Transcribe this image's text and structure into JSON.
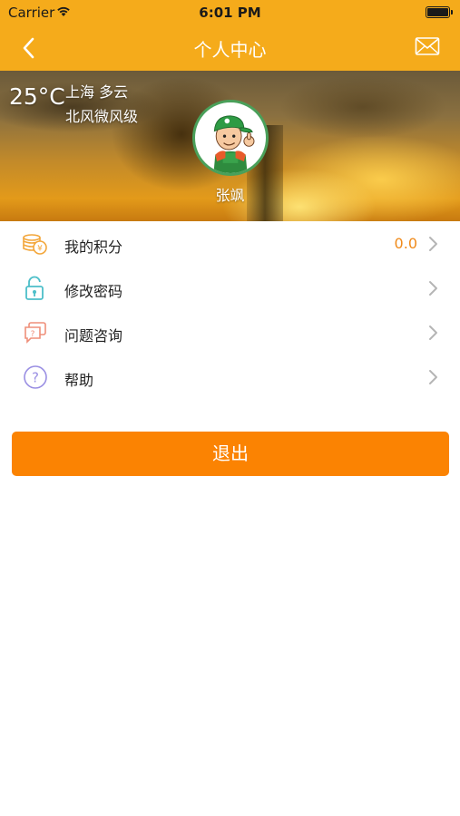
{
  "status_bar": {
    "carrier": "Carrier",
    "time": "6:01 PM"
  },
  "nav": {
    "title": "个人中心",
    "back_icon": "chevron-left-icon",
    "mail_icon": "envelope-icon"
  },
  "weather": {
    "temperature": "25°C",
    "city_condition": "上海 多云",
    "wind": "北风微风级"
  },
  "profile": {
    "username": "张飒"
  },
  "menu": [
    {
      "label": "我的积分",
      "value": "0.0",
      "icon": "coins-icon"
    },
    {
      "label": "修改密码",
      "value": "",
      "icon": "unlock-icon"
    },
    {
      "label": "问题咨询",
      "value": "",
      "icon": "chat-question-icon"
    },
    {
      "label": "帮助",
      "value": "",
      "icon": "help-circle-icon"
    }
  ],
  "logout_label": "退出",
  "colors": {
    "brand": "#f5ab1b",
    "accent": "#fb8302",
    "value_text": "#f08a1a"
  }
}
